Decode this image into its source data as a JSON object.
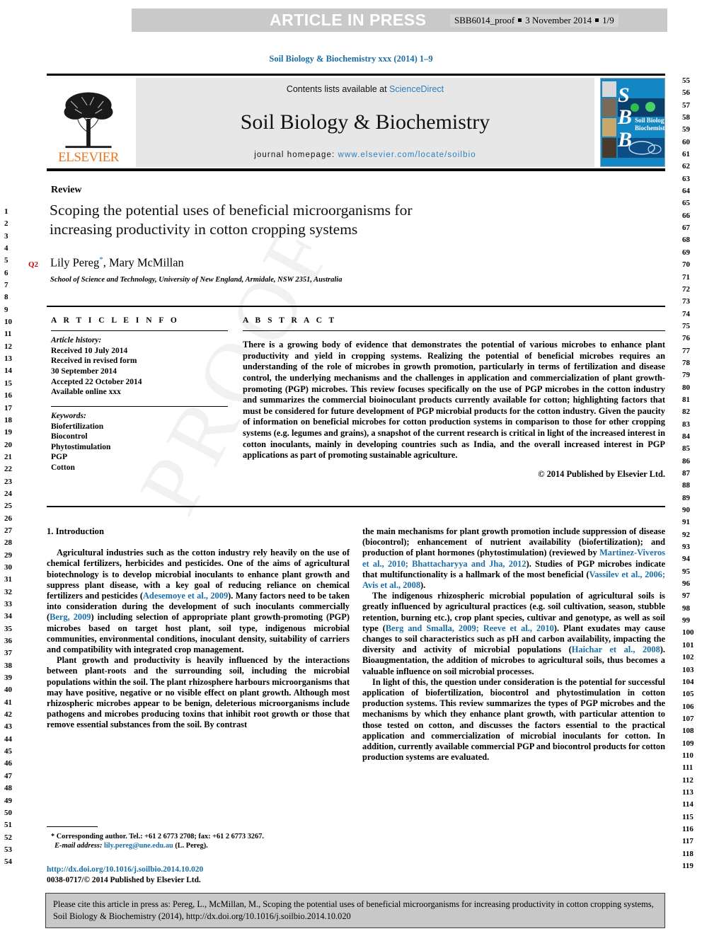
{
  "header_strip": {
    "article_in_press": "ARTICLE IN PRESS",
    "proof_id": "SBB6014_proof",
    "proof_date": "3 November 2014",
    "proof_page": "1/9"
  },
  "journal": {
    "reference_line": "Soil Biology & Biochemistry xxx (2014) 1–9",
    "contents_prefix": "Contents lists available at ",
    "contents_link": "ScienceDirect",
    "title": "Soil Biology & Biochemistry",
    "homepage_label": "journal homepage:",
    "homepage_url": "www.elsevier.com/locate/soilbio",
    "publisher_wordmark": "ELSEVIER",
    "cover_letters": [
      "S",
      "B",
      "B"
    ],
    "cover_caption": "Soil Biology & Biochemistry"
  },
  "article": {
    "type_label": "Review",
    "title": "Scoping the potential uses of beneficial microorganisms for increasing productivity in cotton cropping systems",
    "query_marker": "Q2",
    "authors": "Lily Pereg",
    "corresponding_mark": "*",
    "authors_rest": ", Mary McMillan",
    "affiliation": "School of Science and Technology, University of New England, Armidale, NSW 2351, Australia"
  },
  "article_info": {
    "heading": "A R T I C L E   I N F O",
    "history_label": "Article history:",
    "history": [
      "Received 10 July 2014",
      "Received in revised form",
      "30 September 2014",
      "Accepted 22 October 2014",
      "Available online xxx"
    ],
    "keywords_label": "Keywords:",
    "keywords": [
      "Biofertilization",
      "Biocontrol",
      "Phytostimulation",
      "PGP",
      "Cotton"
    ]
  },
  "abstract": {
    "heading": "A B S T R A C T",
    "text": "There is a growing body of evidence that demonstrates the potential of various microbes to enhance plant productivity and yield in cropping systems. Realizing the potential of beneficial microbes requires an understanding of the role of microbes in growth promotion, particularly in terms of fertilization and disease control, the underlying mechanisms and the challenges in application and commercialization of plant growth-promoting (PGP) microbes. This review focuses specifically on the use of PGP microbes in the cotton industry and summarizes the commercial bioinoculant products currently available for cotton; highlighting factors that must be considered for future development of PGP microbial products for the cotton industry. Given the paucity of information on beneficial microbes for cotton production systems in comparison to those for other cropping systems (e.g. legumes and grains), a snapshot of the current research is critical in light of the increased interest in cotton inoculants, mainly in developing countries such as India, and the overall increased interest in PGP applications as part of promoting sustainable agriculture.",
    "copyright": "© 2014 Published by Elsevier Ltd."
  },
  "body": {
    "section_heading": "1. Introduction",
    "left_paragraphs": [
      "Agricultural industries such as the cotton industry rely heavily on the use of chemical fertilizers, herbicides and pesticides. One of the aims of agricultural biotechnology is to develop microbial inoculants to enhance plant growth and suppress plant disease, with a key goal of reducing reliance on chemical fertilizers and pesticides (Adesemoye et al., 2009). Many factors need to be taken into consideration during the development of such inoculants commercially (Berg, 2009) including selection of appropriate plant growth-promoting (PGP) microbes based on target host plant, soil type, indigenous microbial communities, environmental conditions, inoculant density, suitability of carriers and compatibility with integrated crop management.",
      "Plant growth and productivity is heavily influenced by the interactions between plant-roots and the surrounding soil, including the microbial populations within the soil. The plant rhizosphere harbours microorganisms that may have positive, negative or no visible effect on plant growth. Although most rhizospheric microbes appear to be benign, deleterious microorganisms include pathogens and microbes producing toxins that inhibit root growth or those that remove essential substances from the soil. By contrast"
    ],
    "right_paragraphs": [
      "the main mechanisms for plant growth promotion include suppression of disease (biocontrol); enhancement of nutrient availability (biofertilization); and production of plant hormones (phytostimulation) (reviewed by Martinez-Viveros et al., 2010; Bhattacharyya and Jha, 2012). Studies of PGP microbes indicate that multifunctionality is a hallmark of the most beneficial (Vassilev et al., 2006; Avis et al., 2008).",
      "The indigenous rhizospheric microbial population of agricultural soils is greatly influenced by agricultural practices (e.g. soil cultivation, season, stubble retention, burning etc.), crop plant species, cultivar and genotype, as well as soil type (Berg and Smalla, 2009; Reeve et al., 2010). Plant exudates may cause changes to soil characteristics such as pH and carbon availability, impacting the diversity and activity of microbial populations (Haichar et al., 2008). Bioaugmentation, the addition of microbes to agricultural soils, thus becomes a valuable influence on soil microbial processes.",
      "In light of this, the question under consideration is the potential for successful application of biofertilization, biocontrol and phytostimulation in cotton production systems. This review summarizes the types of PGP microbes and the mechanisms by which they enhance plant growth, with particular attention to those tested on cotton, and discusses the factors essential to the practical application and commercialization of microbial inoculants for cotton. In addition, currently available commercial PGP and biocontrol products for cotton production systems are evaluated."
    ]
  },
  "footnote": {
    "marker": "*",
    "corresponding": "Corresponding author. Tel.: +61 2 6773 2708; fax: +61 2 6773 3267.",
    "email_label": "E-mail address:",
    "email": "lily.pereg@une.edu.au",
    "email_suffix": "(L. Pereg)."
  },
  "doi_block": {
    "doi_url": "http://dx.doi.org/10.1016/j.soilbio.2014.10.020",
    "issn_line": "0038-0717/© 2014 Published by Elsevier Ltd."
  },
  "cite_footer": {
    "text": "Please cite this article in press as: Pereg, L., McMillan, M., Scoping the potential uses of beneficial microorganisms for increasing productivity in cotton cropping systems, Soil Biology & Biochemistry (2014), http://dx.doi.org/10.1016/j.soilbio.2014.10.020"
  },
  "line_numbers": {
    "left_start": 1,
    "left_end": 54,
    "right_start": 55,
    "right_end": 119
  },
  "colors": {
    "link": "#1a6ea8",
    "elsevier_orange": "#e87722",
    "query_red": "#d00000",
    "strip_grey": "#c9c9c9",
    "panel_grey": "#e7e7e7",
    "cover_blue": "#1386c4"
  },
  "watermark": "PROOF"
}
